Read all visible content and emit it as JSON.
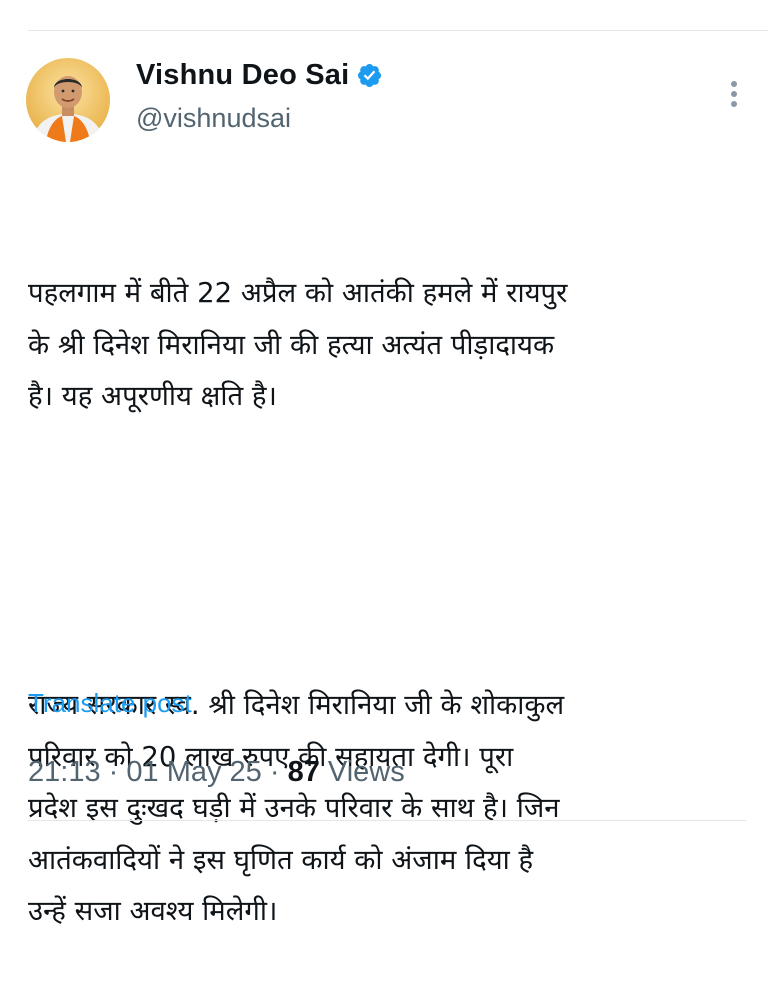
{
  "author": {
    "name": "Vishnu Deo Sai",
    "handle": "@vishnudsai",
    "verified": true,
    "verified_color": "#1d9bf0",
    "avatar_icon": "profile-photo"
  },
  "post": {
    "paragraph_1": "पहलगाम में बीते 22 अप्रैल को आतंकी हमले में रायपुर\nके श्री दिनेश मिरानिया जी की हत्या अत्यंत पीड़ादायक\nहै। यह अपूरणीय क्षति है।",
    "paragraph_2": "राज्य सरकार स्व. श्री दिनेश मिरानिया जी के शोकाकुल\nपरिवार को 20 लाख रुपए की सहायता देगी। पूरा\nप्रदेश इस दुःखद घड़ी में उनके परिवार के साथ है। जिन\nआतंकवादियों ने इस घृणित कार्य को अंजाम दिया है\nउन्हें सजा अवश्य मिलेगी।"
  },
  "actions": {
    "translate_label": "Translate post",
    "more_icon": "more-vertical-icon"
  },
  "meta": {
    "time": "21:13",
    "separator": "·",
    "date": "01 May 25",
    "views_count": "87",
    "views_label": "Views"
  },
  "colors": {
    "link": "#1d9bf0",
    "secondary_text": "#536471",
    "primary_text": "#0f1419"
  }
}
